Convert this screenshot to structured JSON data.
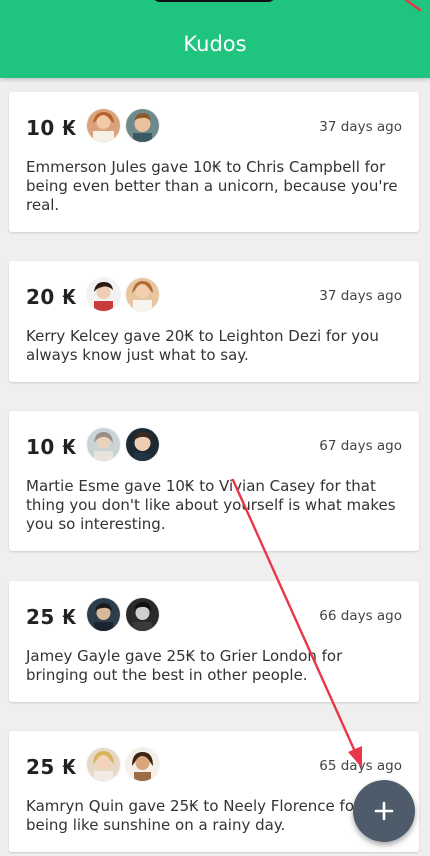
{
  "appbar": {
    "title": "Kudos"
  },
  "kudos": [
    {
      "amount": "10 ₭",
      "giver_avatar": "woman-avatar",
      "receiver_avatar": "man-avatar",
      "date": "37 days ago",
      "message": "Emmerson Jules gave 10₭ to Chris Campbell for being even better than a unicorn, because you're real."
    },
    {
      "amount": "20 ₭",
      "giver_avatar": "woman-avatar",
      "receiver_avatar": "woman-avatar",
      "date": "37 days ago",
      "message": "Kerry Kelcey gave 20₭ to Leighton Dezi for you always know just what to say."
    },
    {
      "amount": "10 ₭",
      "giver_avatar": "woman-avatar",
      "receiver_avatar": "child-avatar",
      "date": "67 days ago",
      "message": "Martie Esme gave 10₭ to Vivian Casey for that thing you don't like about yourself is what makes you so interesting."
    },
    {
      "amount": "25 ₭",
      "giver_avatar": "man-avatar",
      "receiver_avatar": "man-avatar",
      "date": "66 days ago",
      "message": "Jamey Gayle gave 25₭ to Grier London for bringing out the best in other people."
    },
    {
      "amount": "25 ₭",
      "giver_avatar": "woman-avatar",
      "receiver_avatar": "woman-avatar",
      "date": "65 days ago",
      "message": "Kamryn Quin gave 25₭ to Neely Florence for being like sunshine on a rainy day."
    }
  ],
  "fab": {
    "icon": "plus-icon"
  },
  "colors": {
    "appbar": "#1fc47f",
    "fab": "#4e5b6a",
    "annotation_arrow": "#e8364a"
  }
}
